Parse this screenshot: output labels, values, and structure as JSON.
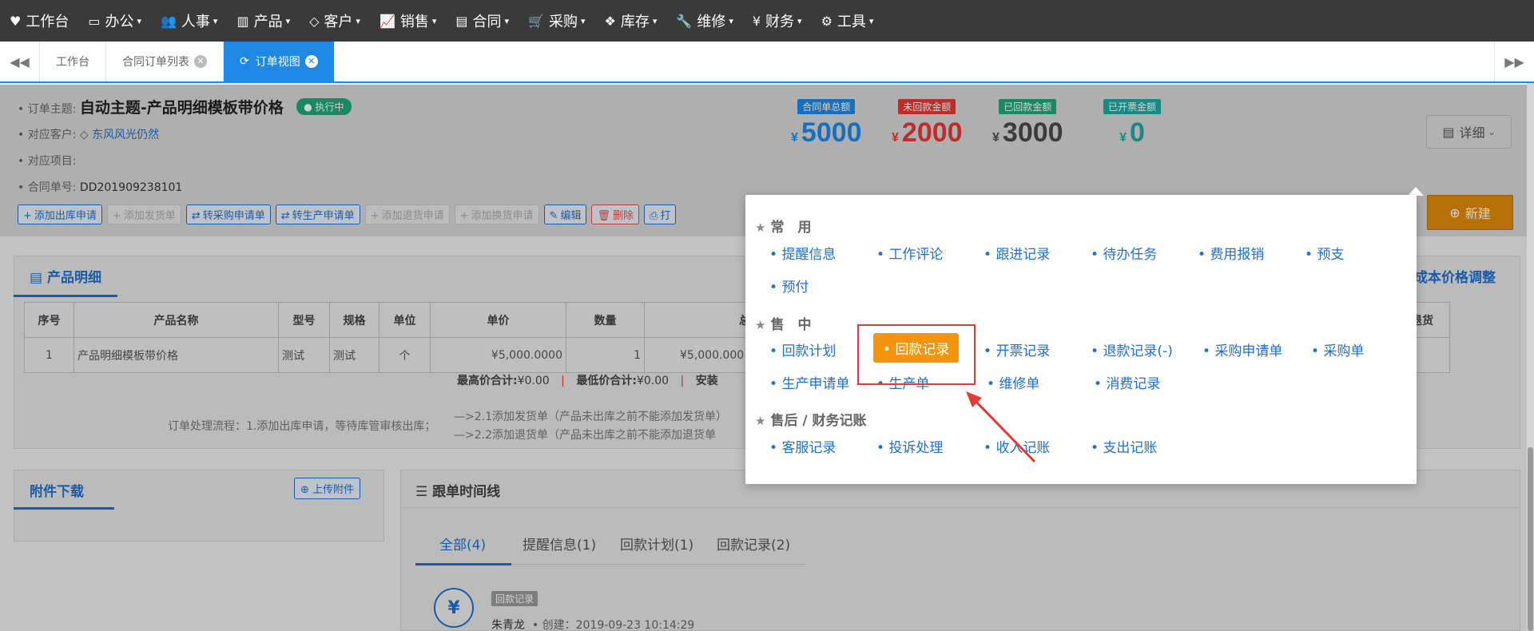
{
  "nav": [
    {
      "icon": "heart-icon",
      "glyph": "♥",
      "label": "工作台"
    },
    {
      "icon": "laptop-icon",
      "glyph": "▭",
      "label": "办公"
    },
    {
      "icon": "users-icon",
      "glyph": "👥",
      "label": "人事"
    },
    {
      "icon": "barcode-icon",
      "glyph": "▥",
      "label": "产品"
    },
    {
      "icon": "diamond-icon",
      "glyph": "◇",
      "label": "客户"
    },
    {
      "icon": "line-chart-icon",
      "glyph": "📈",
      "label": "销售"
    },
    {
      "icon": "contract-icon",
      "glyph": "▤",
      "label": "合同"
    },
    {
      "icon": "cart-icon",
      "glyph": "🛒",
      "label": "采购"
    },
    {
      "icon": "cubes-icon",
      "glyph": "❖",
      "label": "库存"
    },
    {
      "icon": "wrench-icon",
      "glyph": "🔧",
      "label": "维修"
    },
    {
      "icon": "yen-icon",
      "glyph": "¥",
      "label": "财务"
    },
    {
      "icon": "gear-icon",
      "glyph": "⚙",
      "label": "工具"
    }
  ],
  "tabs": [
    {
      "label": "工作台"
    },
    {
      "label": "合同订单列表"
    },
    {
      "label": "订单视图"
    }
  ],
  "header": {
    "subject_key": "订单主题:",
    "subject": "自动主题-产品明细模板带价格",
    "status": "执行中",
    "customer_key": "对应客户:",
    "customer": "东风风光仍然",
    "project_key": "对应项目:",
    "contract_key": "合同单号:",
    "contract_no": "DD201909238101"
  },
  "amounts": [
    {
      "label": "合同单总额",
      "yen": "¥",
      "value": "5000",
      "color": "#1e88e5"
    },
    {
      "label": "未回款金额",
      "yen": "¥",
      "value": "2000",
      "color": "#e53935"
    },
    {
      "label": "已回款金额",
      "yen": "¥",
      "value": "3000",
      "color": "#4a4a4a",
      "label_color": "#1fa87a"
    },
    {
      "label": "已开票金额",
      "yen": "¥",
      "value": "0",
      "color": "#1fa8a0"
    }
  ],
  "detail_label": "详细",
  "new_label": "新建",
  "actions": [
    {
      "label": "添加出库申请",
      "style": "normal",
      "glyph": "+"
    },
    {
      "label": "添加发货单",
      "style": "dis",
      "glyph": "+"
    },
    {
      "label": "转采购申请单",
      "style": "normal",
      "glyph": "⇄"
    },
    {
      "label": "转生产申请单",
      "style": "normal",
      "glyph": "⇄"
    },
    {
      "label": "添加退货申请",
      "style": "dis",
      "glyph": "+"
    },
    {
      "label": "添加换货申请",
      "style": "dis",
      "glyph": "+"
    },
    {
      "label": "编辑",
      "style": "normal",
      "glyph": "✎"
    },
    {
      "label": "删除",
      "style": "red",
      "glyph": "🗑"
    },
    {
      "label": "打",
      "style": "normal",
      "glyph": "⎙"
    }
  ],
  "product": {
    "title": "产品明细",
    "cost_adjust": "成本价格调整",
    "columns": [
      "序号",
      "产品名称",
      "型号",
      "规格",
      "单位",
      "单价",
      "数量",
      "总价",
      "已退货"
    ],
    "rows": [
      {
        "no": "1",
        "name": "产品明细模板带价格",
        "model": "测试",
        "spec": "测试",
        "unit": "个",
        "price": "¥5,000.0000",
        "qty": "1",
        "total": "¥5,000.000"
      }
    ],
    "sum_high": "最高价合计:",
    "sum_high_val": "¥0.00",
    "sum_low": "最低价合计:",
    "sum_low_val": "¥0.00",
    "sum_install": "安装",
    "flow_main": "订单处理流程：1.添加出库申请，等待库管审核出库；",
    "flow_21": "—>2.1添加发货单（产品未出库之前不能添加发货单）",
    "flow_22": "—>2.2添加退货单（产品未出库之前不能添加退货单"
  },
  "attach": {
    "title": "附件下载",
    "upload": "上传附件"
  },
  "timeline": {
    "title": "跟单时间线",
    "tabs": [
      "全部(4)",
      "提醒信息(1)",
      "回款计划(1)",
      "回款记录(2)"
    ],
    "entry_badge": "回款记录",
    "entry_user": "朱青龙",
    "entry_meta": "• 创建：2019-09-23 10:14:29"
  },
  "popup": {
    "sec_common": "常　用",
    "common": [
      "提醒信息",
      "工作评论",
      "跟进记录",
      "待办任务",
      "费用报销",
      "预支",
      "预付"
    ],
    "sec_sale": "售　中",
    "sale": [
      "回款计划",
      "回款记录",
      "开票记录",
      "退款记录(-)",
      "采购申请单",
      "采购单",
      "生产申请单",
      "生产单",
      "维修单",
      "消费记录"
    ],
    "sec_after": "售后 / 财务记账",
    "after": [
      "客服记录",
      "投诉处理",
      "收入记账",
      "支出记账"
    ]
  }
}
